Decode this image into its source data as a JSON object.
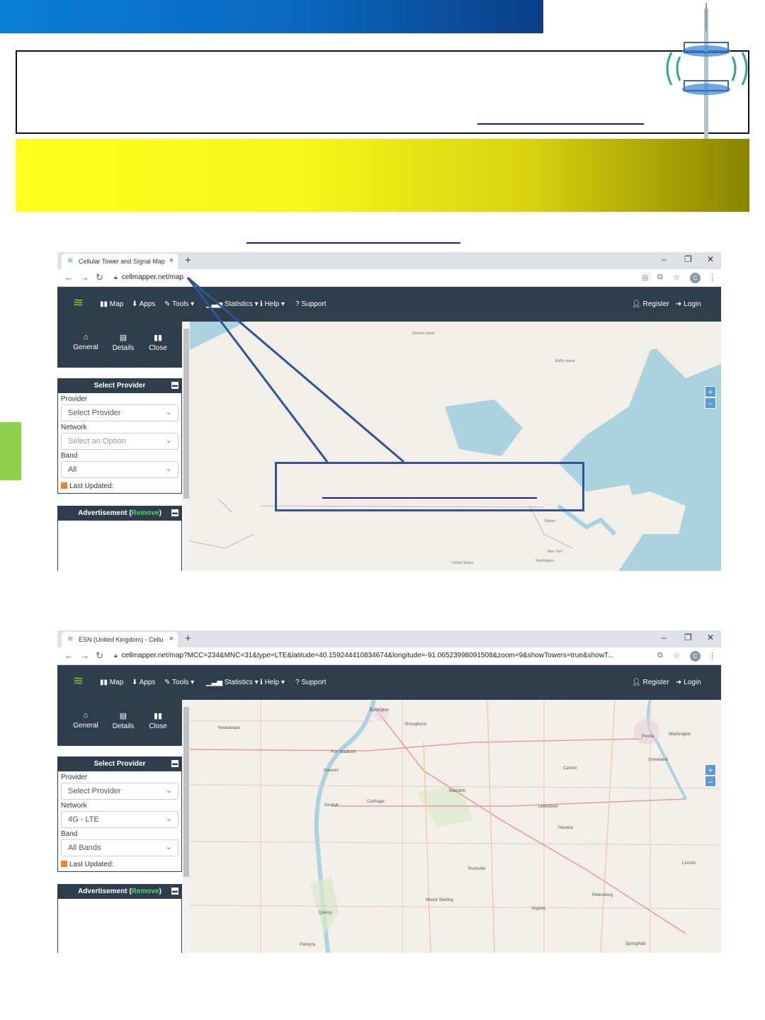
{
  "screenshot1": {
    "tab_title": "Cellular Tower and Signal Map",
    "url": "cellmapper.net/map",
    "nav": {
      "map": "Map",
      "apps": "Apps",
      "tools": "Tools",
      "statistics": "Statistics",
      "help": "Help",
      "support": "Support",
      "register": "Register",
      "login": "Login"
    },
    "side": {
      "general": "General",
      "details": "Details",
      "close": "Close"
    },
    "select_provider": {
      "title": "Select Provider",
      "provider_label": "Provider",
      "provider_value": "Select Provider",
      "network_label": "Network",
      "network_value": "Select an Option",
      "band_label": "Band",
      "band_value": "All",
      "last_updated": "Last Updated:"
    },
    "ad": {
      "title": "Advertisement",
      "remove": "Remove"
    },
    "map_labels": {
      "victoria": "Victoria Island",
      "baffin": "Baffin Island",
      "ottawa": "Ottawa",
      "newyork": "New York",
      "washington": "Washington",
      "us": "United States"
    }
  },
  "screenshot2": {
    "tab_title": "ESN (United Kingdom) - Cellu",
    "url": "cellmapper.net/map?MCC=234&MNC=31&type=LTE&latitude=40.159244410834674&longitude=-91.06523998091508&zoom=9&showTowers=true&showT...",
    "nav": {
      "map": "Map",
      "apps": "Apps",
      "tools": "Tools",
      "statistics": "Statistics",
      "help": "Help",
      "support": "Support",
      "register": "Register",
      "login": "Login"
    },
    "side": {
      "general": "General",
      "details": "Details",
      "close": "Close"
    },
    "select_provider": {
      "title": "Select Provider",
      "provider_label": "Provider",
      "provider_value": "Select Provider",
      "network_label": "Network",
      "network_value": "4G - LTE",
      "band_label": "Band",
      "band_value": "All Bands",
      "last_updated": "Last Updated:"
    },
    "ad": {
      "title": "Advertisement",
      "remove": "Remove"
    },
    "map_labels": {
      "burlington": "Burlington",
      "keosauqua": "Keosauqua",
      "stronghurst": "Stronghurst",
      "peoria": "Peoria",
      "washington": "Washington",
      "fortmadison": "Fort Madison",
      "groveland": "Groveland",
      "nauvoo": "Nauvoo",
      "canton": "Canton",
      "macomb": "Macomb",
      "keokuk": "Keokuk",
      "carthage": "Carthage",
      "lewistown": "Lewistown",
      "havana": "Havana",
      "rushville": "Rushville",
      "lincoln": "Lincoln",
      "mountsterling": "Mount Sterling",
      "petersburg": "Petersburg",
      "virginia": "Virginia",
      "quincy": "Quincy",
      "palmyra": "Palmyra",
      "springfield": "Springfield"
    }
  },
  "colors": {
    "banner_blue": "#0a68c0",
    "nav_dark": "#2f3e4d",
    "yellow": "#ffff1e",
    "accent_green": "#8dd14a",
    "callout_blue": "#2f5597"
  }
}
